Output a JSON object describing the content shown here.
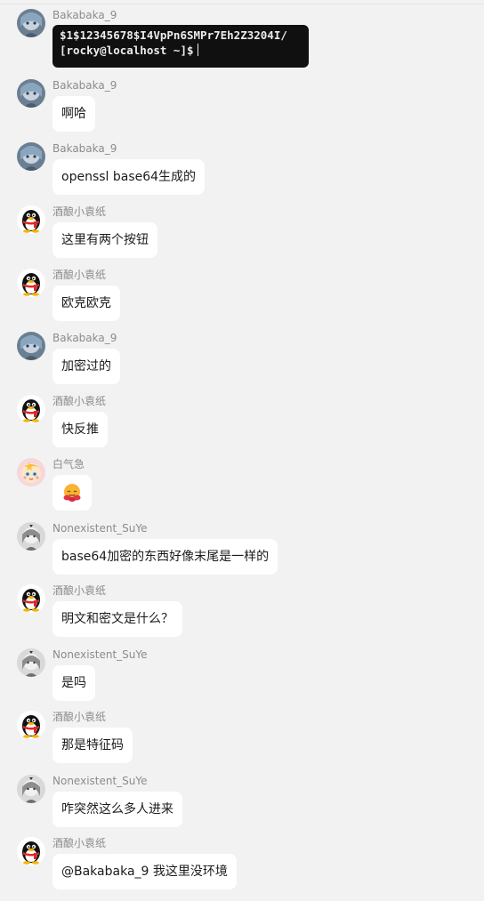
{
  "terminal": {
    "line1": "$1$12345678$I4VpPn6SMPr7Eh2Z3204I/",
    "line2": "[rocky@localhost ~]$"
  },
  "messages": [
    {
      "user": "Bakabaka_9",
      "text": ""
    },
    {
      "user": "Bakabaka_9",
      "text": "啊哈"
    },
    {
      "user": "Bakabaka_9",
      "text": "openssl base64生成的"
    },
    {
      "user": "酒酿小袁纸",
      "text": "这里有两个按钮"
    },
    {
      "user": "酒酿小袁纸",
      "text": "欧克欧克"
    },
    {
      "user": "Bakabaka_9",
      "text": "加密过的"
    },
    {
      "user": "酒酿小袁纸",
      "text": "快反推"
    },
    {
      "user": "白气急",
      "text": ""
    },
    {
      "user": "Nonexistent_SuYe",
      "text": "base64加密的东西好像末尾是一样的"
    },
    {
      "user": "酒酿小袁纸",
      "text": "明文和密文是什么？"
    },
    {
      "user": "Nonexistent_SuYe",
      "text": "是吗"
    },
    {
      "user": "酒酿小袁纸",
      "text": "那是特征码"
    },
    {
      "user": "Nonexistent_SuYe",
      "text": "咋突然这么多人进来"
    },
    {
      "user": "酒酿小袁纸",
      "text": "@Bakabaka_9 我这里没环境"
    }
  ],
  "avatars": {
    "bakabaka": "anime-avatar-icon",
    "qq": "qq-penguin-icon",
    "baiqiji": "cartoon-avatar-icon",
    "suye": "sketch-avatar-icon"
  },
  "emoji": "hug-emoji-icon"
}
